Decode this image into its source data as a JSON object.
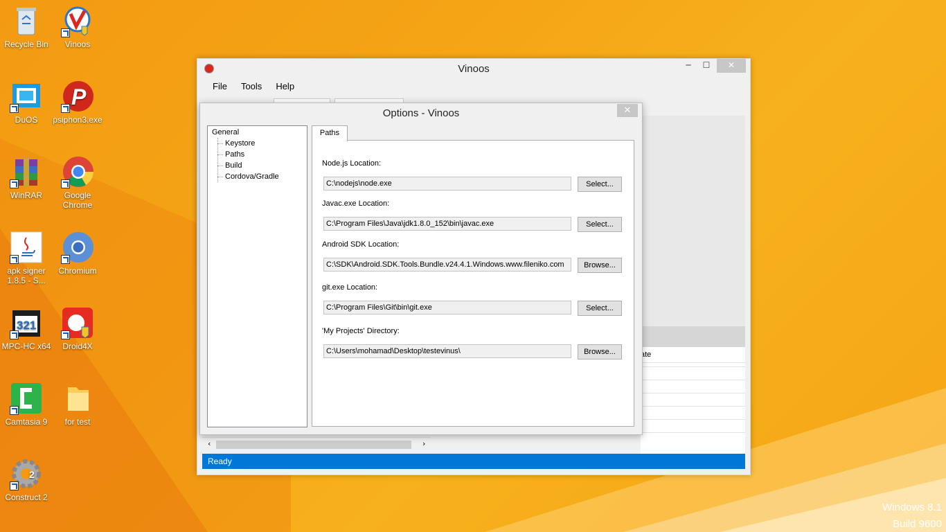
{
  "desktop": {
    "icons": [
      {
        "label": "Recycle Bin",
        "icon": "recycle-bin-icon"
      },
      {
        "label": "Vinoos",
        "icon": "vinoos-icon"
      },
      {
        "label": "DuOS",
        "icon": "duos-icon"
      },
      {
        "label": "psiphon3.exe",
        "icon": "psiphon-icon"
      },
      {
        "label": "WinRAR",
        "icon": "winrar-icon"
      },
      {
        "label": "Google Chrome",
        "icon": "chrome-icon"
      },
      {
        "label": "apk signer 1.8.5 - S...",
        "icon": "java-icon"
      },
      {
        "label": "Chromium",
        "icon": "chromium-icon"
      },
      {
        "label": "MPC-HC x64",
        "icon": "mpc-hc-icon"
      },
      {
        "label": "Droid4X",
        "icon": "droid4x-icon"
      },
      {
        "label": "Camtasia 9",
        "icon": "camtasia-icon"
      },
      {
        "label": "for test",
        "icon": "folder-icon"
      },
      {
        "label": "Construct 2",
        "icon": "construct-icon"
      }
    ],
    "watermark_line1": "Windows 8.1",
    "watermark_line2": "Build 9600"
  },
  "main_window": {
    "title": "Vinoos",
    "menu": [
      "File",
      "Tools",
      "Help"
    ],
    "status": "Ready",
    "grid_header_partial": "ate",
    "accent_color": "#0078d7"
  },
  "options_dialog": {
    "title": "Options - Vinoos",
    "tree": {
      "root": "General",
      "children": [
        "Keystore",
        "Paths",
        "Build",
        "Cordova/Gradle"
      ]
    },
    "tab": "Paths",
    "fields": [
      {
        "label": "Node.js Location:",
        "value": "C:\\nodejs\\node.exe",
        "button": "Select..."
      },
      {
        "label": "Javac.exe Location:",
        "value": "C:\\Program Files\\Java\\jdk1.8.0_152\\bin\\javac.exe",
        "button": "Select..."
      },
      {
        "label": "Android SDK Location:",
        "value": "C:\\SDK\\Android.SDK.Tools.Bundle.v24.4.1.Windows.www.fileniko.com",
        "button": "Browse..."
      },
      {
        "label": "git.exe Location:",
        "value": "C:\\Program Files\\Git\\bin\\git.exe",
        "button": "Select..."
      },
      {
        "label": "'My Projects' Directory:",
        "value": "C:\\Users\\mohamad\\Desktop\\testevinus\\",
        "button": "Browse..."
      }
    ]
  }
}
